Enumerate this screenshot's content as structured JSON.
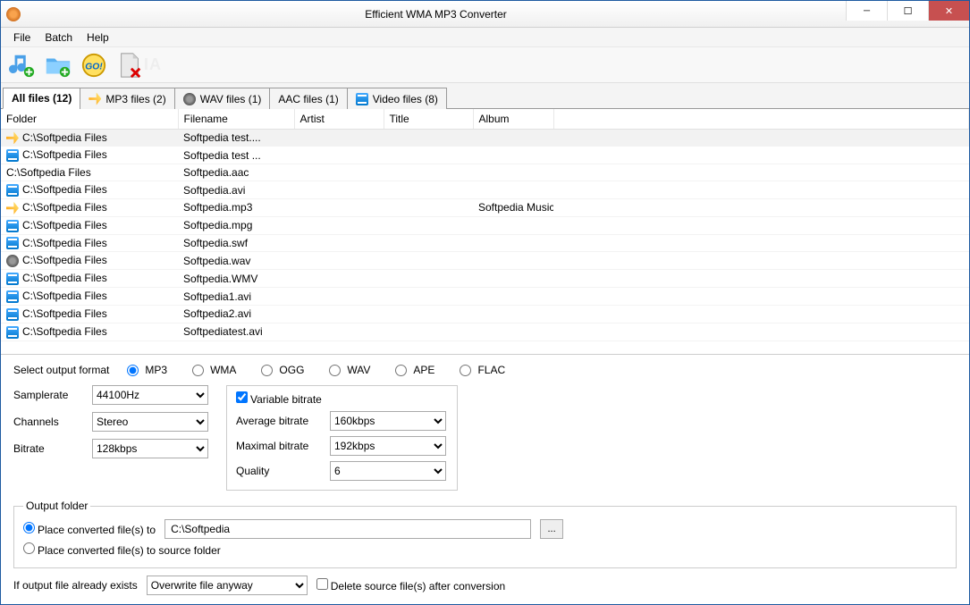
{
  "window": {
    "title": "Efficient WMA MP3 Converter"
  },
  "menu": {
    "file": "File",
    "batch": "Batch",
    "help": "Help"
  },
  "tabs": [
    {
      "label": "All files (12)",
      "icon": "",
      "active": true
    },
    {
      "label": "MP3 files (2)",
      "icon": "mp3"
    },
    {
      "label": "WAV files (1)",
      "icon": "wav"
    },
    {
      "label": "AAC files (1)",
      "icon": ""
    },
    {
      "label": "Video files (8)",
      "icon": "video"
    }
  ],
  "columns": [
    "Folder",
    "Filename",
    "Artist",
    "Title",
    "Album"
  ],
  "rows": [
    {
      "icon": "mp3",
      "folder": "C:\\Softpedia Files",
      "filename": "Softpedia test....",
      "artist": "",
      "title": "",
      "album": ""
    },
    {
      "icon": "video",
      "folder": "C:\\Softpedia Files",
      "filename": "Softpedia test ...",
      "artist": "",
      "title": "",
      "album": ""
    },
    {
      "icon": "",
      "folder": "C:\\Softpedia Files",
      "filename": "Softpedia.aac",
      "artist": "",
      "title": "",
      "album": ""
    },
    {
      "icon": "video",
      "folder": "C:\\Softpedia Files",
      "filename": "Softpedia.avi",
      "artist": "",
      "title": "",
      "album": ""
    },
    {
      "icon": "mp3",
      "folder": "C:\\Softpedia Files",
      "filename": "Softpedia.mp3",
      "artist": "",
      "title": "",
      "album": "Softpedia Music"
    },
    {
      "icon": "video",
      "folder": "C:\\Softpedia Files",
      "filename": "Softpedia.mpg",
      "artist": "",
      "title": "",
      "album": ""
    },
    {
      "icon": "video",
      "folder": "C:\\Softpedia Files",
      "filename": "Softpedia.swf",
      "artist": "",
      "title": "",
      "album": ""
    },
    {
      "icon": "wav",
      "folder": "C:\\Softpedia Files",
      "filename": "Softpedia.wav",
      "artist": "",
      "title": "",
      "album": ""
    },
    {
      "icon": "video",
      "folder": "C:\\Softpedia Files",
      "filename": "Softpedia.WMV",
      "artist": "",
      "title": "",
      "album": ""
    },
    {
      "icon": "video",
      "folder": "C:\\Softpedia Files",
      "filename": "Softpedia1.avi",
      "artist": "",
      "title": "",
      "album": ""
    },
    {
      "icon": "video",
      "folder": "C:\\Softpedia Files",
      "filename": "Softpedia2.avi",
      "artist": "",
      "title": "",
      "album": ""
    },
    {
      "icon": "video",
      "folder": "C:\\Softpedia Files",
      "filename": "Softpediatest.avi",
      "artist": "",
      "title": "",
      "album": ""
    }
  ],
  "settings": {
    "select_output_format_label": "Select output format",
    "formats": [
      "MP3",
      "WMA",
      "OGG",
      "WAV",
      "APE",
      "FLAC"
    ],
    "selected_format": "MP3",
    "samplerate_label": "Samplerate",
    "samplerate_value": "44100Hz",
    "channels_label": "Channels",
    "channels_value": "Stereo",
    "bitrate_label": "Bitrate",
    "bitrate_value": "128kbps",
    "variable_bitrate_label": "Variable bitrate",
    "variable_bitrate_checked": true,
    "avg_bitrate_label": "Average bitrate",
    "avg_bitrate_value": "160kbps",
    "max_bitrate_label": "Maximal bitrate",
    "max_bitrate_value": "192kbps",
    "quality_label": "Quality",
    "quality_value": "6",
    "output_folder_legend": "Output folder",
    "place_to_label": "Place converted file(s) to",
    "place_to_checked": true,
    "output_path": "C:\\Softpedia",
    "browse_label": "...",
    "place_source_label": "Place converted file(s) to source folder",
    "if_exists_label": "If output file already exists",
    "overwrite_value": "Overwrite file anyway",
    "delete_source_label": "Delete source file(s) after conversion",
    "delete_source_checked": false
  }
}
